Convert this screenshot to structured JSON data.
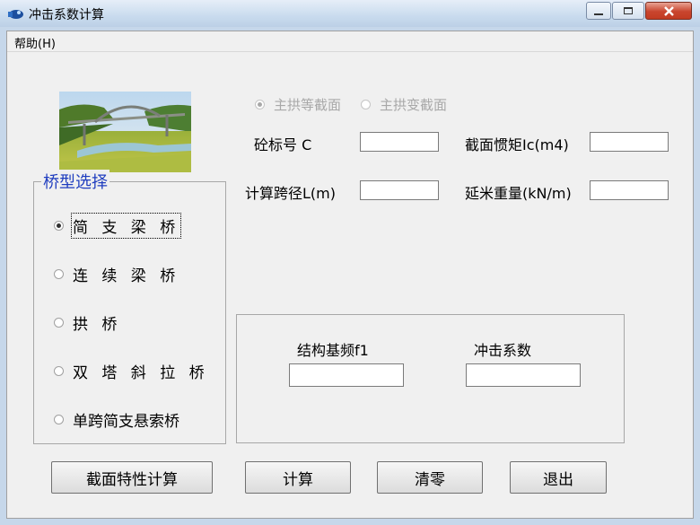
{
  "window": {
    "title": "冲击系数计算",
    "controls": {
      "minimize": "minimize-icon",
      "maximize": "maximize-icon",
      "close": "close-icon"
    }
  },
  "menu": {
    "help": "帮助(H)"
  },
  "arch_options": {
    "equal_section": "主拱等截面",
    "variable_section": "主拱变截面"
  },
  "fields": {
    "concrete_grade": {
      "label": "砼标号 C",
      "value": ""
    },
    "moment_inertia": {
      "label": "截面惯矩Ic(m4)",
      "value": ""
    },
    "span": {
      "label": "计算跨径L(m)",
      "value": ""
    },
    "unit_weight": {
      "label": "延米重量(kN/m)",
      "value": ""
    }
  },
  "bridge_type": {
    "title": "桥型选择",
    "options": [
      "简 支 梁 桥",
      "连 续 梁 桥",
      "拱 桥",
      "双 塔 斜 拉 桥",
      "单跨简支悬索桥"
    ],
    "selected": 0
  },
  "results": {
    "frequency_label": "结构基频f1",
    "frequency_value": "",
    "impact_label": "冲击系数",
    "impact_value": ""
  },
  "buttons": {
    "section_calc": "截面特性计算",
    "calc": "计算",
    "clear": "清零",
    "exit": "退出"
  },
  "colors": {
    "group_title": "#1f3dbf",
    "window_frame": "#c6d7ea",
    "face": "#f0f0f0"
  }
}
